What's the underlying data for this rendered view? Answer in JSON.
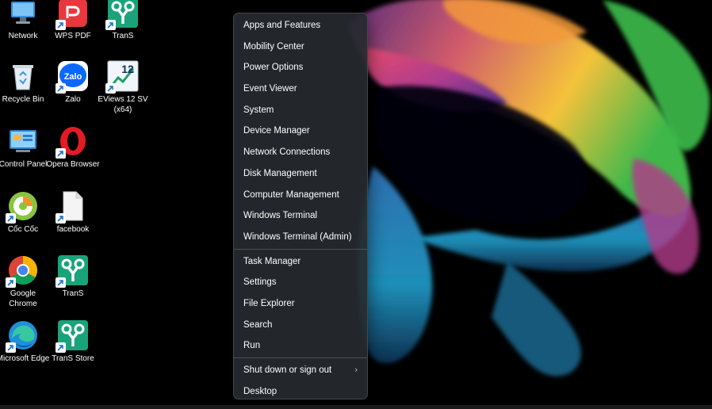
{
  "desktop_icons": [
    {
      "id": "network",
      "label": "Network",
      "icon": "network-icon",
      "shortcut": false
    },
    {
      "id": "wps-pdf",
      "label": "WPS PDF",
      "icon": "wps-pdf-icon",
      "shortcut": true
    },
    {
      "id": "trans-top",
      "label": "TranS",
      "icon": "trans-icon",
      "shortcut": true
    },
    {
      "id": "recycle-bin",
      "label": "Recycle Bin",
      "icon": "recycle-bin-icon",
      "shortcut": false
    },
    {
      "id": "zalo",
      "label": "Zalo",
      "icon": "zalo-icon",
      "shortcut": true
    },
    {
      "id": "eviews",
      "label": "EViews 12 SV (x64)",
      "icon": "eviews-icon",
      "shortcut": true,
      "badge": "12"
    },
    {
      "id": "control-panel",
      "label": "Control Panel",
      "icon": "control-panel-icon",
      "shortcut": false
    },
    {
      "id": "opera",
      "label": "Opera Browser",
      "icon": "opera-icon",
      "shortcut": true
    },
    {
      "id": "coc-coc",
      "label": "Cốc Cốc",
      "icon": "coc-coc-icon",
      "shortcut": true
    },
    {
      "id": "facebook",
      "label": "facebook",
      "icon": "file-icon",
      "shortcut": true
    },
    {
      "id": "chrome",
      "label": "Google Chrome",
      "icon": "chrome-icon",
      "shortcut": true
    },
    {
      "id": "trans-mid",
      "label": "TranS",
      "icon": "trans-icon",
      "shortcut": true
    },
    {
      "id": "edge",
      "label": "Microsoft Edge",
      "icon": "edge-icon",
      "shortcut": true
    },
    {
      "id": "trans-store",
      "label": "TranS Store",
      "icon": "trans-icon",
      "shortcut": true
    }
  ],
  "context_menu": {
    "groups": [
      [
        {
          "label": "Apps and Features"
        },
        {
          "label": "Mobility Center"
        },
        {
          "label": "Power Options"
        },
        {
          "label": "Event Viewer"
        },
        {
          "label": "System"
        },
        {
          "label": "Device Manager"
        },
        {
          "label": "Network Connections"
        },
        {
          "label": "Disk Management"
        },
        {
          "label": "Computer Management"
        },
        {
          "label": "Windows Terminal"
        },
        {
          "label": "Windows Terminal (Admin)"
        }
      ],
      [
        {
          "label": "Task Manager"
        },
        {
          "label": "Settings"
        },
        {
          "label": "File Explorer"
        },
        {
          "label": "Search"
        },
        {
          "label": "Run"
        }
      ],
      [
        {
          "label": "Shut down or sign out",
          "submenu": true,
          "chevron": "›"
        },
        {
          "label": "Desktop"
        }
      ]
    ]
  },
  "colors": {
    "menu_background": "#262a30",
    "menu_text": "#ffffff",
    "desktop_background": "#000000",
    "trans_green": "#1aa37a",
    "wps_red": "#e8373d",
    "zalo_blue": "#0a68ff",
    "opera_red": "#e41b23"
  }
}
